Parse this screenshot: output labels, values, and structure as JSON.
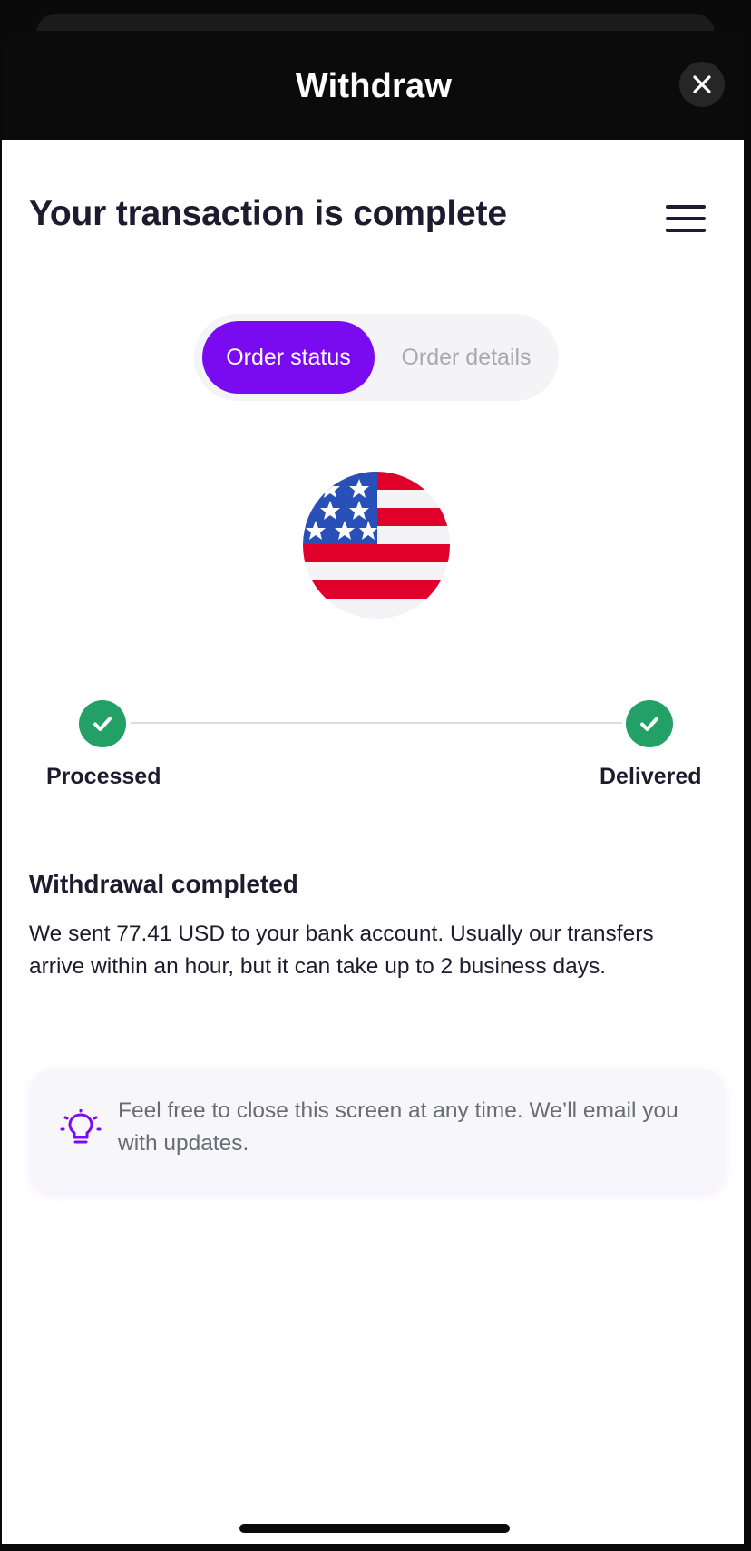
{
  "header": {
    "title": "Withdraw",
    "close_icon": "close-icon"
  },
  "page": {
    "title": "Your transaction is complete",
    "menu_icon": "hamburger-menu-icon"
  },
  "tabs": [
    {
      "label": "Order status",
      "active": true
    },
    {
      "label": "Order details",
      "active": false
    }
  ],
  "currency": {
    "flag_icon": "us-flag-icon"
  },
  "progress": {
    "steps": [
      {
        "label": "Processed",
        "status": "done"
      },
      {
        "label": "Delivered",
        "status": "done"
      }
    ]
  },
  "status": {
    "title": "Withdrawal completed",
    "message": "We sent 77.41 USD to your bank account. Usually our transfers arrive within an hour, but it can take up to 2 business days."
  },
  "tip": {
    "icon": "lightbulb-icon",
    "text": "Feel free to close this screen at any time. We’ll email you with updates."
  },
  "colors": {
    "accent": "#7a0af0",
    "success": "#23a065",
    "text": "#1e1b2e",
    "muted": "#a9a9b1"
  }
}
